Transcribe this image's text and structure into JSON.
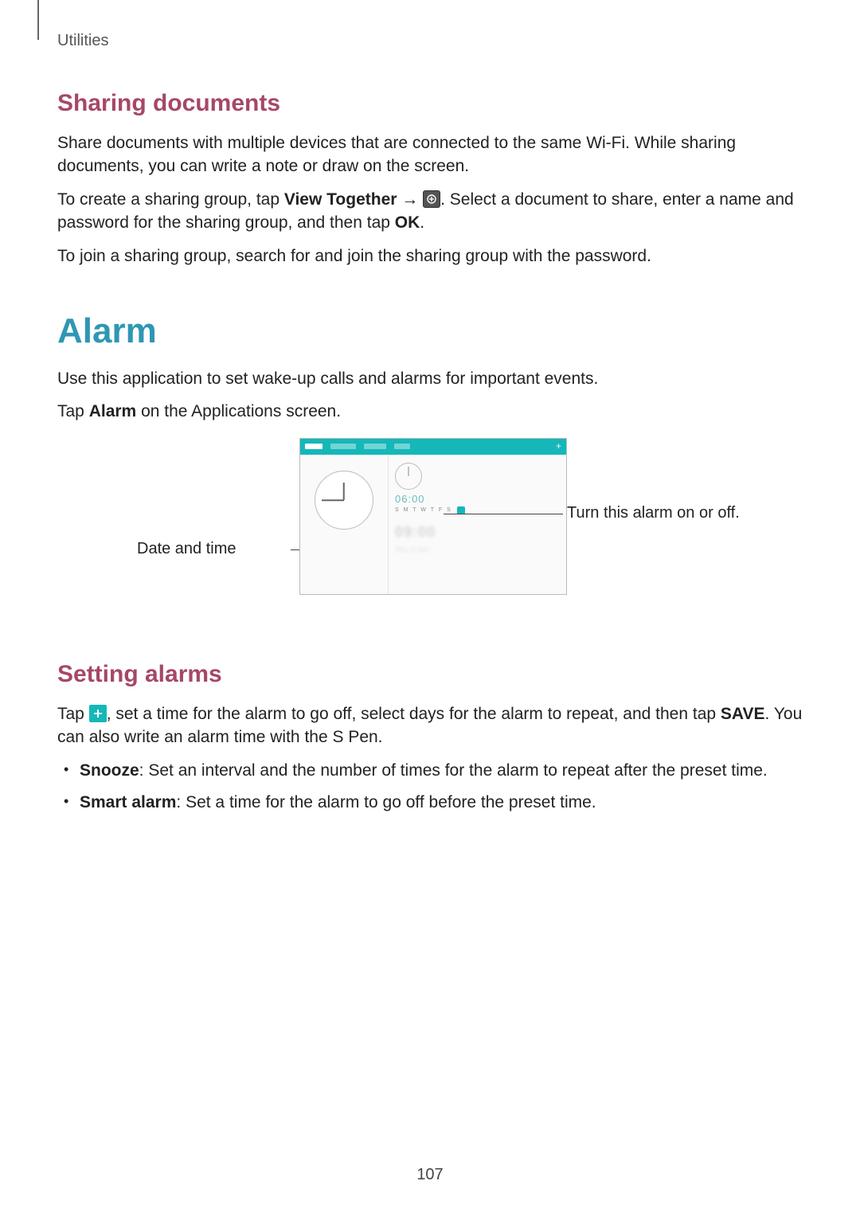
{
  "breadcrumb": "Utilities",
  "sharing": {
    "heading": "Sharing documents",
    "p1": "Share documents with multiple devices that are connected to the same Wi-Fi. While sharing documents, you can write a note or draw on the screen.",
    "p2a": "To create a sharing group, tap ",
    "p2_bold": "View Together",
    "p2b": " → ",
    "p2c": ". Select a document to share, enter a name and password for the sharing group, and then tap ",
    "p2_bold2": "OK",
    "p2d": ".",
    "p3": "To join a sharing group, search for and join the sharing group with the password."
  },
  "alarm": {
    "heading": "Alarm",
    "intro": "Use this application to set wake-up calls and alarms for important events.",
    "tap_a": "Tap ",
    "tap_bold": "Alarm",
    "tap_b": " on the Applications screen.",
    "callout_left": "Date and time",
    "callout_right": "Turn this alarm on or off.",
    "screenshot": {
      "time": "06:00",
      "days": "S M T W T F S",
      "blur_time": "09:00",
      "blur_sub": "Thu, 5 Jun"
    }
  },
  "setting": {
    "heading": "Setting alarms",
    "p_a": "Tap ",
    "p_b": ", set a time for the alarm to go off, select days for the alarm to repeat, and then tap ",
    "p_bold": "SAVE",
    "p_c": ". You can also write an alarm time with the S Pen.",
    "bullets": [
      {
        "bold": "Snooze",
        "rest": ": Set an interval and the number of times for the alarm to repeat after the preset time."
      },
      {
        "bold": "Smart alarm",
        "rest": ": Set a time for the alarm to go off before the preset time."
      }
    ]
  },
  "page_number": "107"
}
